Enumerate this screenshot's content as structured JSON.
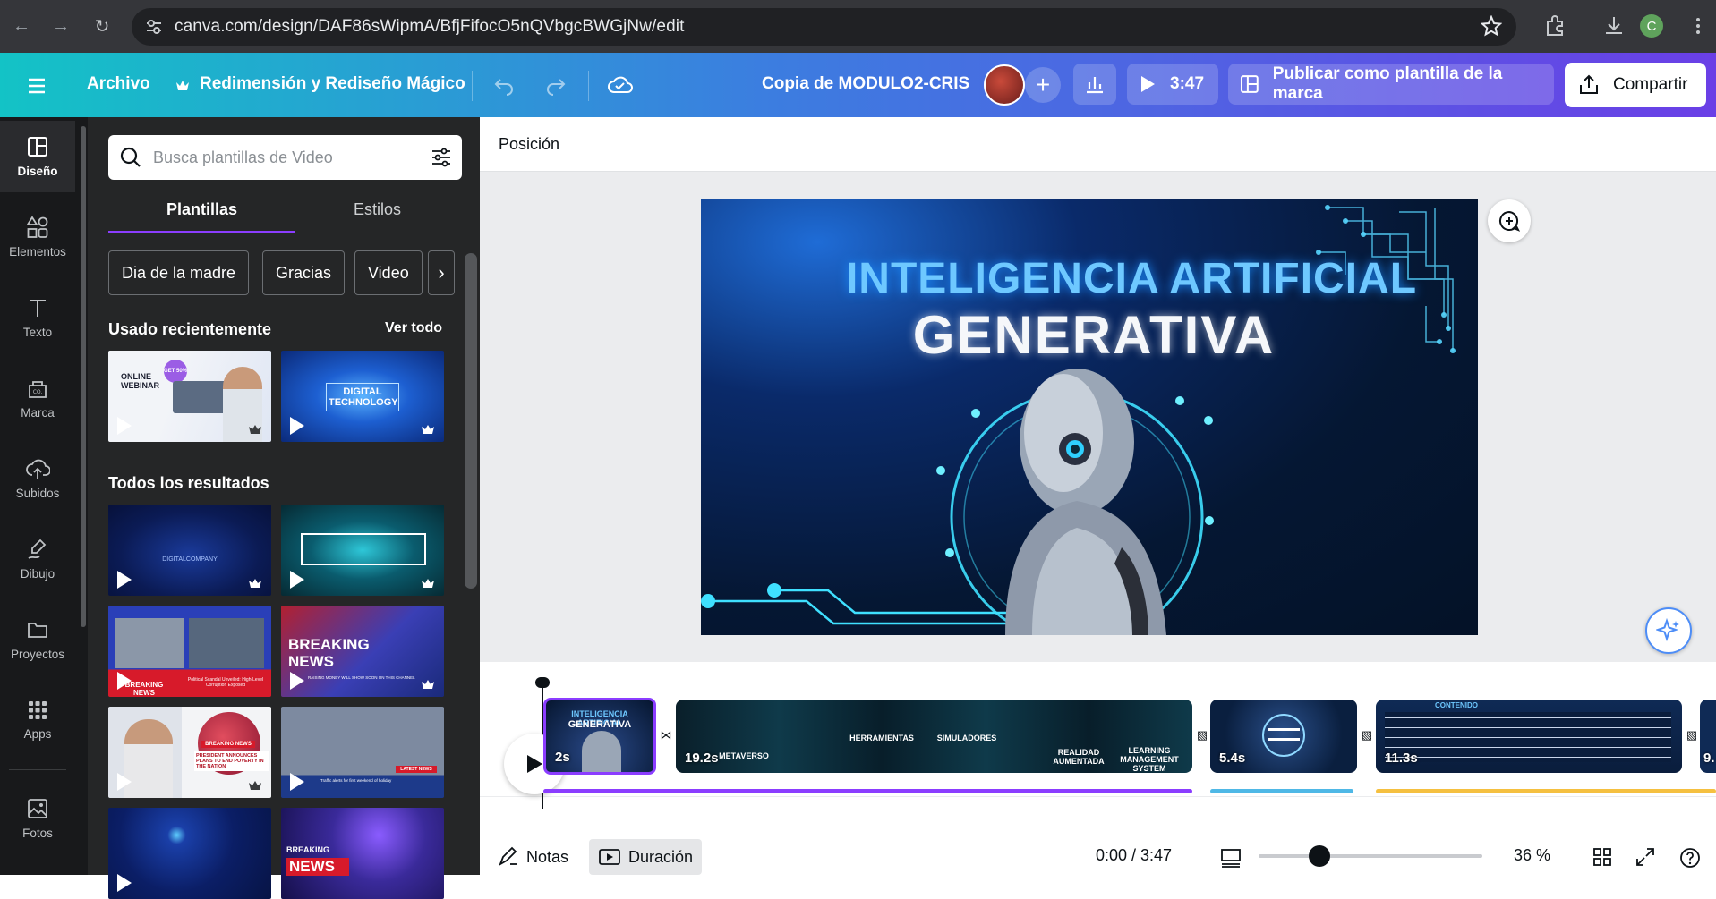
{
  "browser": {
    "url": "canva.com/design/DAF86sWipmA/BfjFifocO5nQVbgcBWGjNw/edit",
    "profile_initial": "C"
  },
  "topbar": {
    "file_label": "Archivo",
    "magic_resize_label": "Redimensión y Rediseño Mágico",
    "design_title": "Copia de MODULO2-CRIS",
    "play_time": "3:47",
    "publish_label": "Publicar como plantilla de la marca",
    "share_label": "Compartir"
  },
  "siderail": {
    "items": [
      {
        "label": "Diseño",
        "icon": "layout-icon"
      },
      {
        "label": "Elementos",
        "icon": "shapes-icon"
      },
      {
        "label": "Texto",
        "icon": "text-icon"
      },
      {
        "label": "Marca",
        "icon": "brand-icon"
      },
      {
        "label": "Subidos",
        "icon": "upload-icon"
      },
      {
        "label": "Dibujo",
        "icon": "draw-icon"
      },
      {
        "label": "Proyectos",
        "icon": "folder-icon"
      },
      {
        "label": "Apps",
        "icon": "apps-icon"
      },
      {
        "label": "Fotos",
        "icon": "photo-icon"
      }
    ]
  },
  "panel": {
    "search_placeholder": "Busca plantillas de Video",
    "tabs": [
      "Plantillas",
      "Estilos"
    ],
    "chips": [
      "Dia de la madre",
      "Gracias",
      "Video"
    ],
    "recent_title": "Usado recientemente",
    "see_all": "Ver todo",
    "all_results_title": "Todos los resultados",
    "recent_thumbs": [
      {
        "text": "ONLINE WEBINAR",
        "badge": "GET 50%"
      },
      {
        "text": "DIGITAL TECHNOLOGY"
      }
    ],
    "result_thumbs": [
      {
        "text": "DIGITALCOMPANY"
      },
      {
        "text": ""
      },
      {
        "text": "BREAKING NEWS",
        "sub": "Political Scandal Unveiled: High-Level Corruption Exposed"
      },
      {
        "text": "BREAKING NEWS",
        "sub": "RAISING MONEY WILL SHOW SOON ON THIS CHANNEL"
      },
      {
        "text": "BREAKING NEWS",
        "sub": "PRESIDENT ANNOUNCES PLANS TO END POVERTY IN THE NATION"
      },
      {
        "text": "LATEST NEWS",
        "sub": "Traffic alerts for first weekend of holiday"
      },
      {
        "text": ""
      },
      {
        "text": "BREAKING",
        "sub": "NEWS"
      }
    ]
  },
  "editor": {
    "subbar_label": "Posición",
    "canvas_title_1": "INTELIGENCIA ARTIFICIAL",
    "canvas_title_2": "GENERATIVA"
  },
  "timeline": {
    "clips": [
      {
        "duration": "2s",
        "title": "INTELIGENCIA ARTIFICIAL",
        "subtitle": "GENERATIVA"
      },
      {
        "duration": "19.2s",
        "labels": [
          "METAVERSO",
          "HERRAMIENTAS",
          "SIMULADORES",
          "REALIDAD AUMENTADA",
          "LEARNING MANAGEMENT SYSTEM"
        ]
      },
      {
        "duration": "5.4s"
      },
      {
        "duration": "11.3s",
        "heading": "CONTENIDO"
      },
      {
        "duration": "9."
      }
    ],
    "audio_colors": [
      "#8b3dff",
      "#4fb8e6",
      "#f5c040"
    ]
  },
  "footer": {
    "notes_label": "Notas",
    "duration_label": "Duración",
    "time": "0:00 / 3:47",
    "zoom": "36 %",
    "zoom_level": 0.27
  },
  "colors": {
    "accent": "#8b3dff",
    "topbar_start": "#13c3c6",
    "topbar_end": "#6a3fe6"
  }
}
